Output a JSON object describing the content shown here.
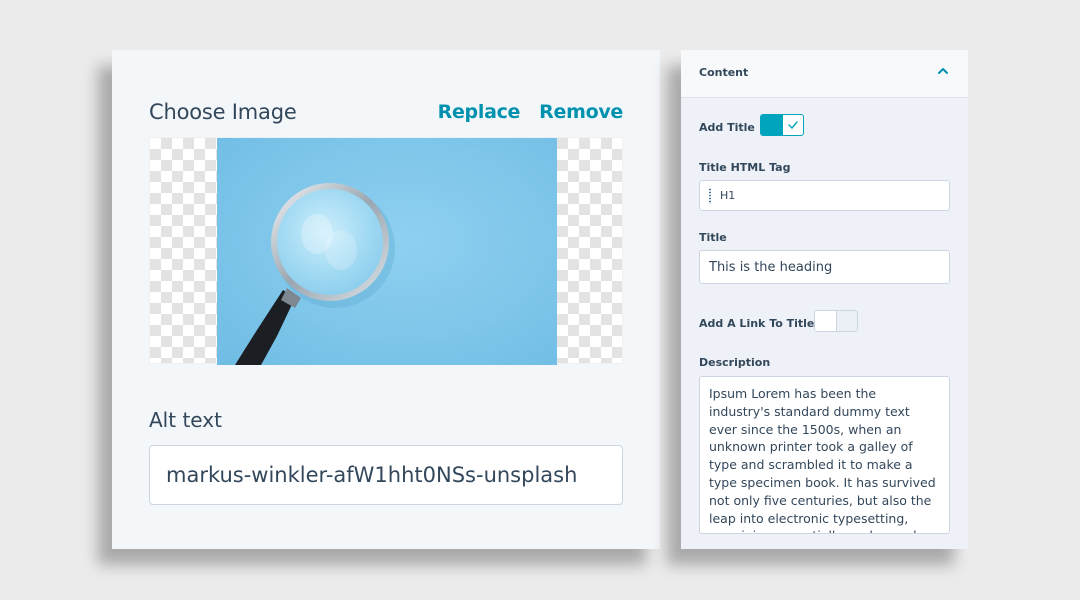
{
  "image_card": {
    "title": "Choose Image",
    "replace_label": "Replace",
    "remove_label": "Remove",
    "alt_label": "Alt text",
    "alt_value": "markus-winkler-afW1hht0NSs-unsplash"
  },
  "panel": {
    "section_title": "Content",
    "collapse_icon": "chevron-up-icon",
    "add_title": {
      "label": "Add Title",
      "enabled": true
    },
    "title_tag": {
      "label": "Title HTML Tag",
      "value": "H1"
    },
    "title": {
      "label": "Title",
      "value": "This is the heading"
    },
    "add_link": {
      "label": "Add A Link To Title",
      "enabled": false
    },
    "description": {
      "label": "Description",
      "value": "Ipsum Lorem  has been the industry's standard dummy text ever since the 1500s, when an unknown printer took a galley of type and scrambled it to make a type specimen book. It has survived not only five centuries, but also the leap into electronic typesetting, remaining essentially unchanged."
    }
  },
  "colors": {
    "accent": "#00a4bd",
    "link": "#0091ae",
    "text": "#33475b",
    "border": "#cbd6e2"
  }
}
